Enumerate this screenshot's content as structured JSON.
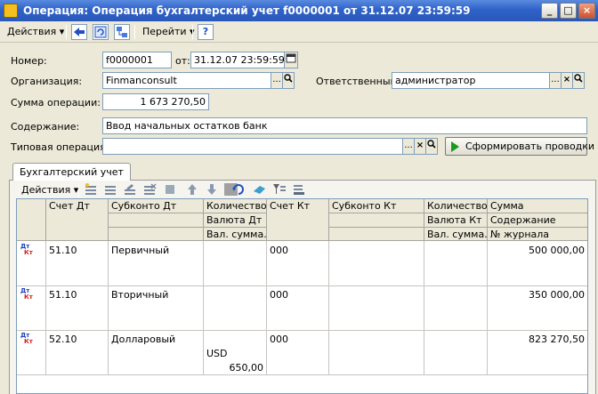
{
  "window": {
    "title": "Операция: Операция бухгалтерский учет f0000001 от 31.12.07 23:59:59",
    "minimize_label": "_",
    "maximize_label": "□",
    "close_label": "×"
  },
  "toolbar": {
    "actions_label": "Действия",
    "goto_label": "Перейти",
    "help_label": "?"
  },
  "form": {
    "number_label": "Номер:",
    "number_value": "f0000001",
    "date_label": "от:",
    "date_value": "31.12.07 23:59:59",
    "org_label": "Организация:",
    "org_value": "Finmanconsult",
    "responsible_label": "Ответственный:",
    "responsible_value": "администратор",
    "sum_label": "Сумма операции:",
    "sum_value": "1 673 270,50",
    "content_label": "Содержание:",
    "content_value": "Ввод начальных остатков банк",
    "typical_label": "Типовая операция:",
    "typical_value": "",
    "generate_button": "Сформировать проводки",
    "ellipsis": "...",
    "clear": "×"
  },
  "tab": {
    "label": "Бухгалтерский учет",
    "actions_label": "Действия"
  },
  "table": {
    "headers": {
      "debit_account": "Счет Дт",
      "subconto_dt": "Субконто Дт",
      "qty_dt": "Количество...",
      "currency_dt": "Валюта Дт",
      "cur_sum_dt": "Вал. сумма...",
      "credit_account": "Счет Кт",
      "subconto_kt": "Субконто Кт",
      "qty_kt": "Количество...",
      "currency_kt": "Валюта Кт",
      "cur_sum_kt": "Вал. сумма...",
      "sum": "Сумма",
      "content": "Содержание",
      "journal": "№ журнала"
    },
    "row_icon_dt": "Дт",
    "row_icon_kt": "Кт",
    "rows": [
      {
        "debit": "51.10",
        "subconto_dt": "Первичный",
        "credit": "000",
        "sum": "500 000,00",
        "currency_dt": "",
        "cur_sum_dt": ""
      },
      {
        "debit": "51.10",
        "subconto_dt": "Вторичный",
        "credit": "000",
        "sum": "350 000,00",
        "currency_dt": "",
        "cur_sum_dt": ""
      },
      {
        "debit": "52.10",
        "subconto_dt": "Долларовый",
        "credit": "000",
        "sum": "823 270,50",
        "currency_dt": "USD",
        "cur_sum_dt": "650,00"
      }
    ]
  },
  "icons": {
    "window": "document-icon",
    "back": "back-arrow-icon",
    "refresh": "refresh-icon",
    "structure": "structure-icon",
    "calendar": "calendar-icon",
    "search": "search-icon"
  },
  "colors": {
    "title_bar": "#2f62c8",
    "dt_mark": "#1a3fc0",
    "kt_mark": "#d02020",
    "generate_play": "#1a9a1a"
  }
}
